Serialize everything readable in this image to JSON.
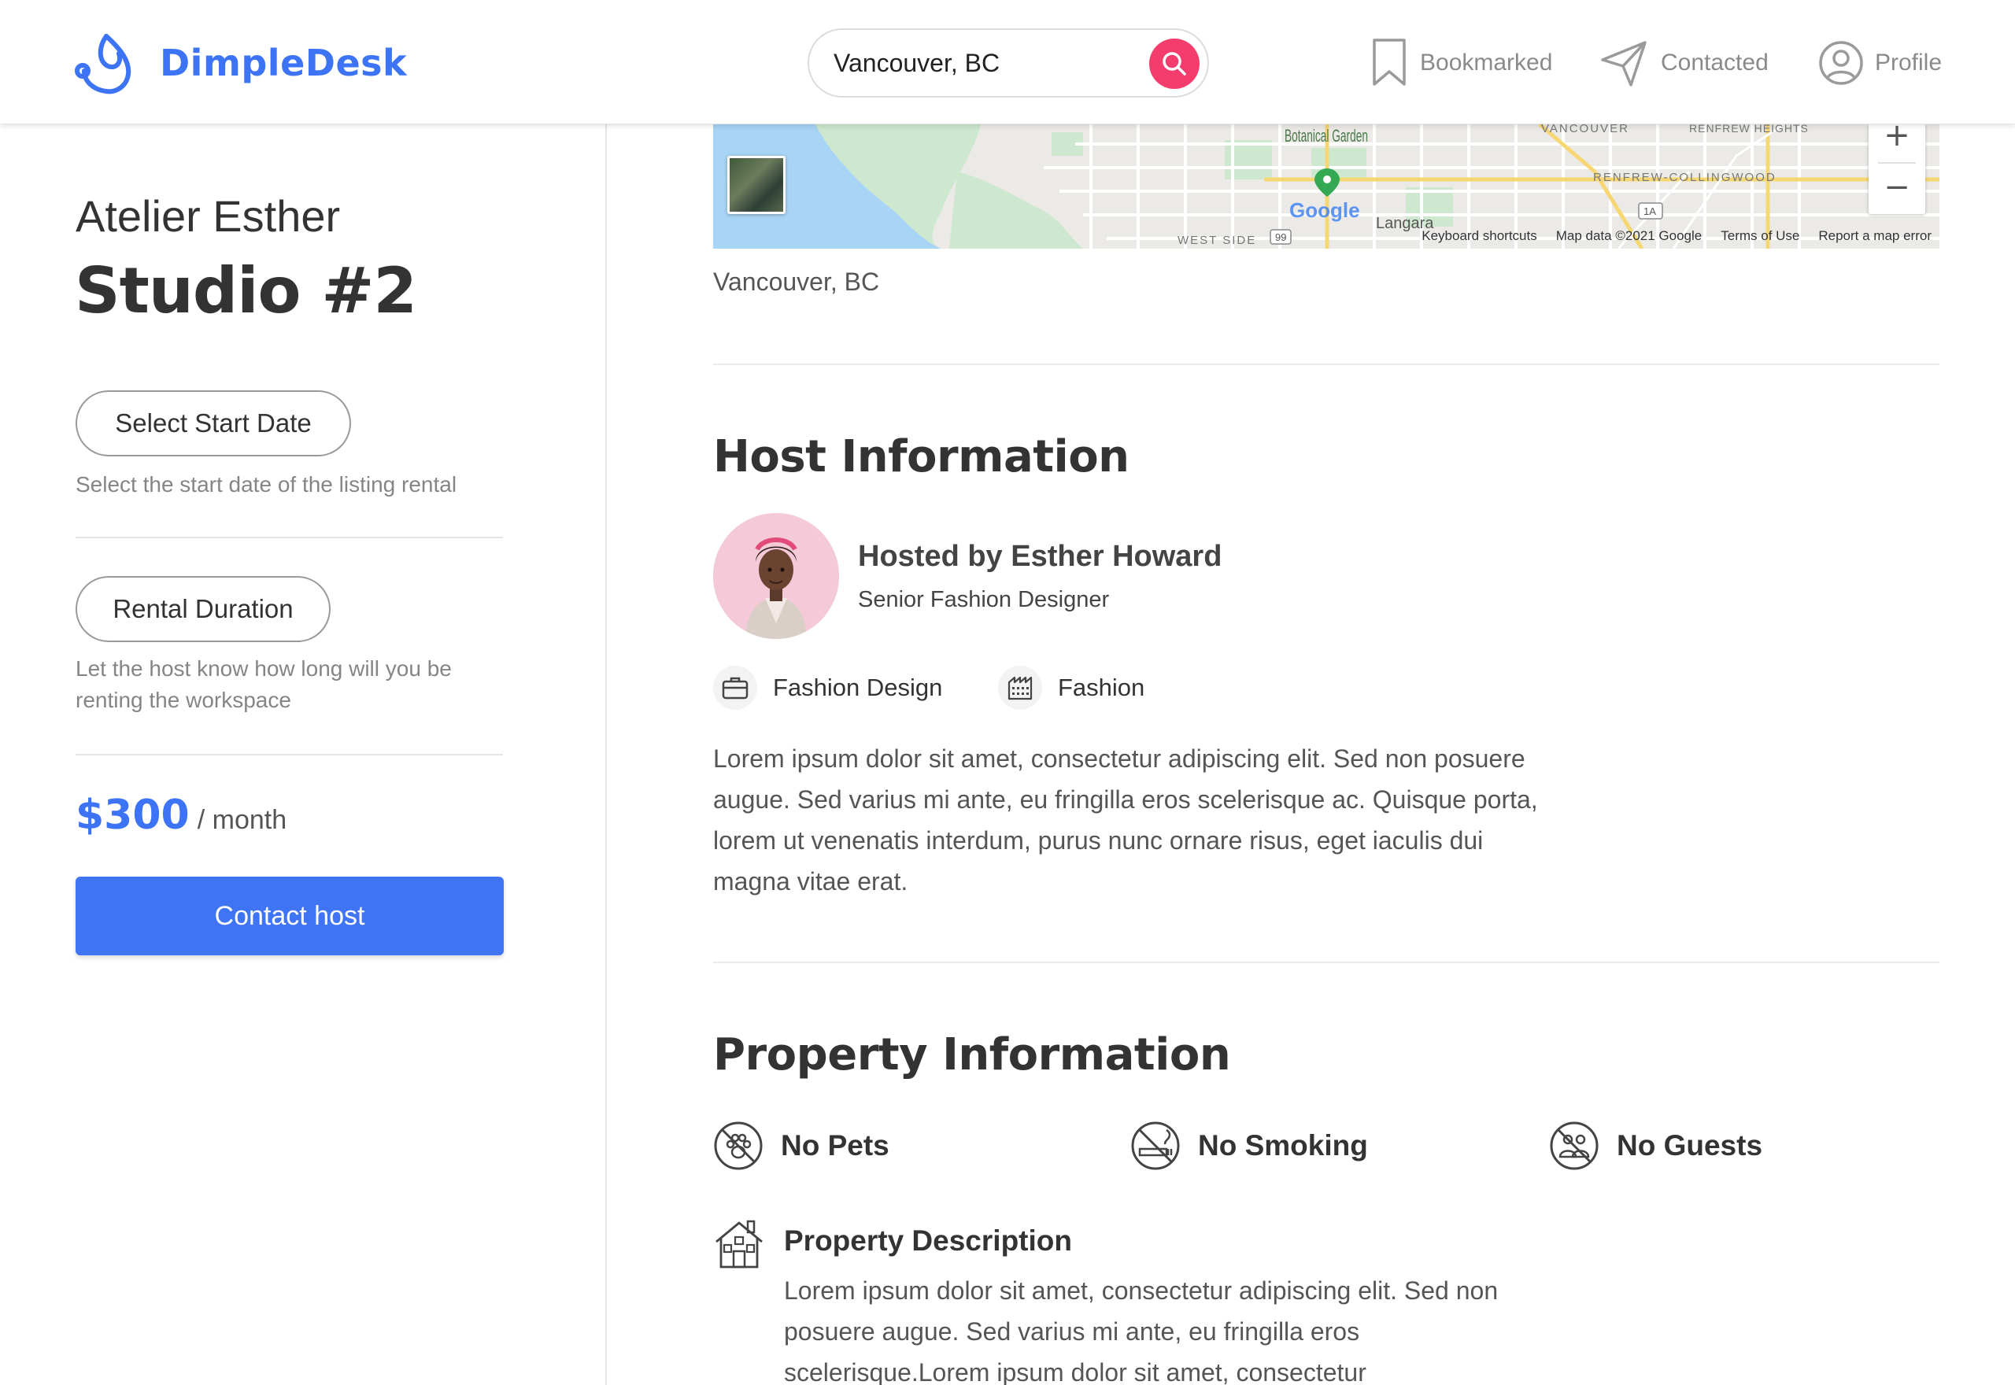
{
  "header": {
    "brand": "DimpleDesk",
    "search": {
      "value": "Vancouver, BC"
    },
    "nav": [
      {
        "label": "Bookmarked",
        "icon": "bookmark-icon"
      },
      {
        "label": "Contacted",
        "icon": "paper-plane-icon"
      },
      {
        "label": "Profile",
        "icon": "user-circle-icon"
      }
    ]
  },
  "listing": {
    "workspace": "Atelier Esther",
    "title": "Studio #2",
    "start_date_button": "Select Start Date",
    "start_date_help": "Select the start date of the listing rental",
    "duration_button": "Rental Duration",
    "duration_help": "Let the host know how long will you be renting the workspace",
    "price": "$300",
    "price_unit": "/ month",
    "contact_button": "Contact host"
  },
  "map": {
    "labels": {
      "botanical": "Botanical Garden",
      "vancouver": "VANCOUVER",
      "renfrew_heights": "RENFREW HEIGHTS",
      "renfrew_collingwood": "RENFREW-COLLINGWOOD",
      "west_side": "WEST SIDE",
      "langara": "Langara",
      "hwy99": "99",
      "hwy1a": "1A",
      "google": "Google"
    },
    "attribution": [
      "Keyboard shortcuts",
      "Map data ©2021 Google",
      "Terms of Use",
      "Report a map error"
    ],
    "zoom_in": "+",
    "zoom_out": "−"
  },
  "location": "Vancouver, BC",
  "host": {
    "section_title": "Host Information",
    "name": "Hosted by Esther Howard",
    "role": "Senior Fashion Designer",
    "tags": [
      {
        "label": "Fashion Design",
        "icon": "briefcase-icon"
      },
      {
        "label": "Fashion",
        "icon": "factory-icon"
      }
    ],
    "description": "Lorem ipsum dolor sit amet, consectetur adipiscing elit. Sed non posuere augue. Sed varius mi ante, eu fringilla eros scelerisque ac. Quisque porta, lorem ut venenatis interdum, purus nunc ornare risus, eget iaculis dui magna vitae erat."
  },
  "property": {
    "section_title": "Property Information",
    "rules": [
      {
        "label": "No Pets",
        "icon": "no-pets-icon"
      },
      {
        "label": "No Smoking",
        "icon": "no-smoking-icon"
      },
      {
        "label": "No Guests",
        "icon": "no-guests-icon"
      }
    ],
    "description_title": "Property Description",
    "description": "Lorem ipsum dolor sit amet, consectetur adipiscing elit. Sed non posuere augue. Sed varius mi ante, eu fringilla eros scelerisque.Lorem ipsum dolor sit amet, consectetur"
  },
  "colors": {
    "brand": "#3d73f5",
    "search_button": "#f43d6d",
    "contact_button": "#3f74f4"
  }
}
